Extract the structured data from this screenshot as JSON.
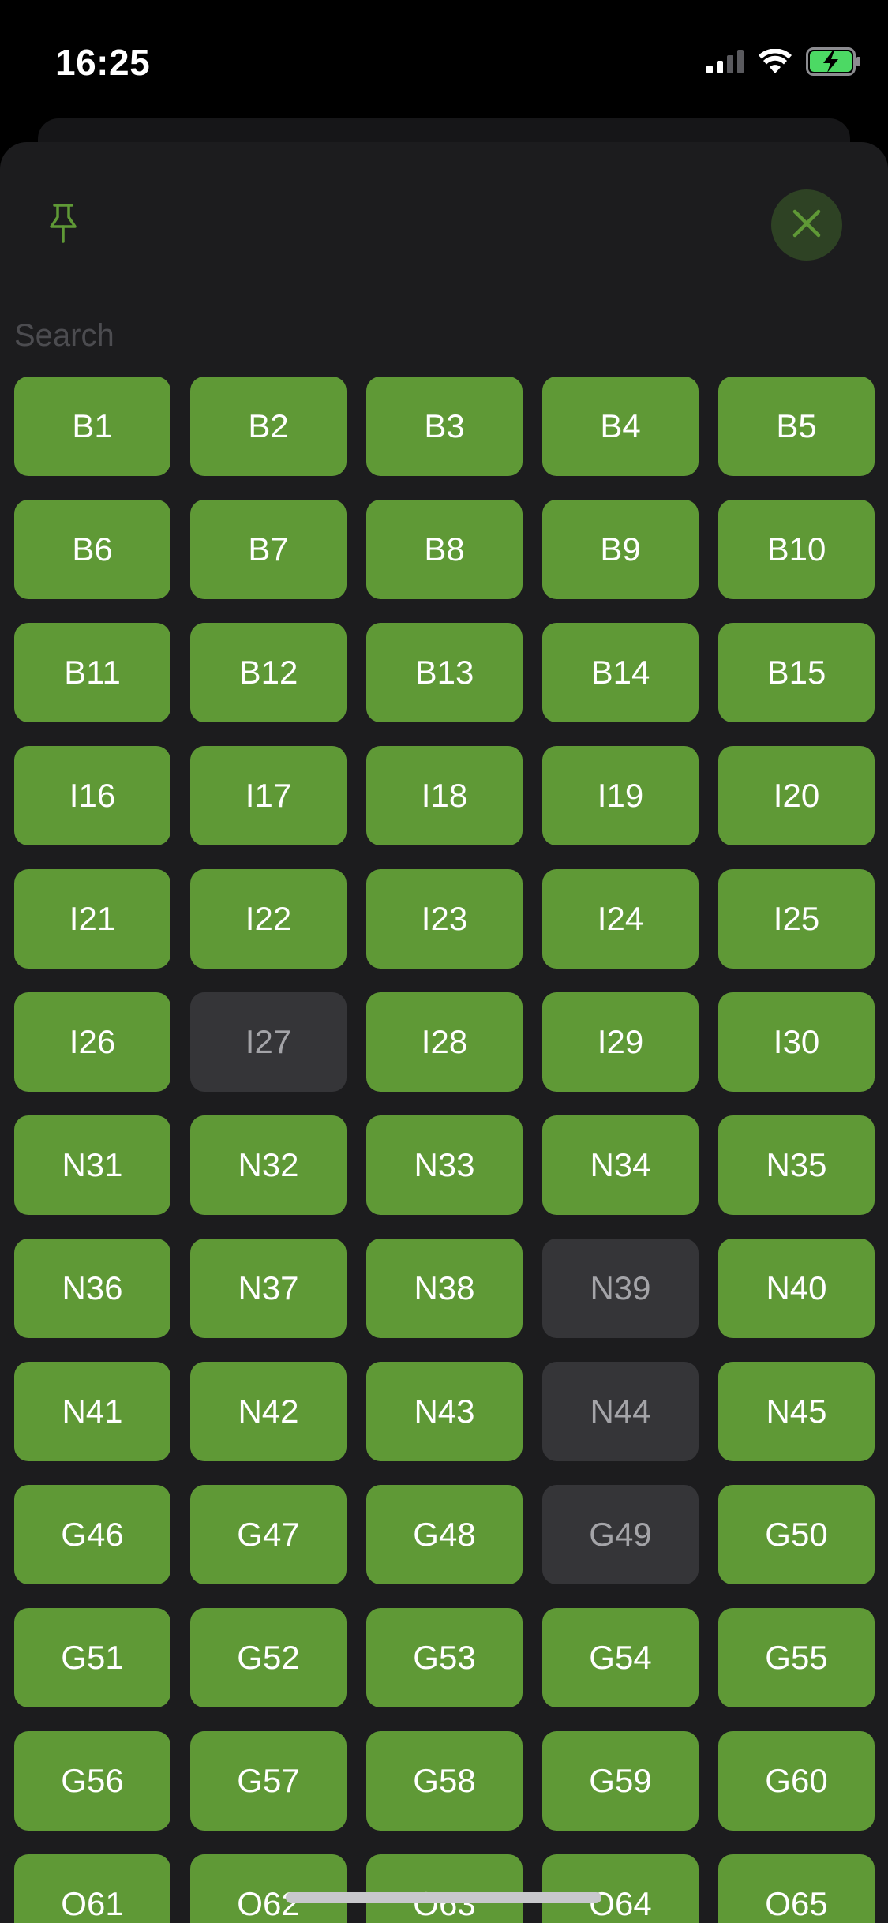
{
  "status_bar": {
    "time": "16:25",
    "icons": [
      "cellular-signal-icon",
      "wifi-icon",
      "battery-charging-icon"
    ]
  },
  "toolbar": {
    "pin_icon": "pin-icon",
    "close_icon": "close-icon"
  },
  "search": {
    "placeholder": "Search",
    "value": ""
  },
  "numbers": [
    {
      "label": "B1",
      "active": true
    },
    {
      "label": "B2",
      "active": true
    },
    {
      "label": "B3",
      "active": true
    },
    {
      "label": "B4",
      "active": true
    },
    {
      "label": "B5",
      "active": true
    },
    {
      "label": "B6",
      "active": true
    },
    {
      "label": "B7",
      "active": true
    },
    {
      "label": "B8",
      "active": true
    },
    {
      "label": "B9",
      "active": true
    },
    {
      "label": "B10",
      "active": true
    },
    {
      "label": "B11",
      "active": true
    },
    {
      "label": "B12",
      "active": true
    },
    {
      "label": "B13",
      "active": true
    },
    {
      "label": "B14",
      "active": true
    },
    {
      "label": "B15",
      "active": true
    },
    {
      "label": "I16",
      "active": true
    },
    {
      "label": "I17",
      "active": true
    },
    {
      "label": "I18",
      "active": true
    },
    {
      "label": "I19",
      "active": true
    },
    {
      "label": "I20",
      "active": true
    },
    {
      "label": "I21",
      "active": true
    },
    {
      "label": "I22",
      "active": true
    },
    {
      "label": "I23",
      "active": true
    },
    {
      "label": "I24",
      "active": true
    },
    {
      "label": "I25",
      "active": true
    },
    {
      "label": "I26",
      "active": true
    },
    {
      "label": "I27",
      "active": false
    },
    {
      "label": "I28",
      "active": true
    },
    {
      "label": "I29",
      "active": true
    },
    {
      "label": "I30",
      "active": true
    },
    {
      "label": "N31",
      "active": true
    },
    {
      "label": "N32",
      "active": true
    },
    {
      "label": "N33",
      "active": true
    },
    {
      "label": "N34",
      "active": true
    },
    {
      "label": "N35",
      "active": true
    },
    {
      "label": "N36",
      "active": true
    },
    {
      "label": "N37",
      "active": true
    },
    {
      "label": "N38",
      "active": true
    },
    {
      "label": "N39",
      "active": false
    },
    {
      "label": "N40",
      "active": true
    },
    {
      "label": "N41",
      "active": true
    },
    {
      "label": "N42",
      "active": true
    },
    {
      "label": "N43",
      "active": true
    },
    {
      "label": "N44",
      "active": false
    },
    {
      "label": "N45",
      "active": true
    },
    {
      "label": "G46",
      "active": true
    },
    {
      "label": "G47",
      "active": true
    },
    {
      "label": "G48",
      "active": true
    },
    {
      "label": "G49",
      "active": false
    },
    {
      "label": "G50",
      "active": true
    },
    {
      "label": "G51",
      "active": true
    },
    {
      "label": "G52",
      "active": true
    },
    {
      "label": "G53",
      "active": true
    },
    {
      "label": "G54",
      "active": true
    },
    {
      "label": "G55",
      "active": true
    },
    {
      "label": "G56",
      "active": true
    },
    {
      "label": "G57",
      "active": true
    },
    {
      "label": "G58",
      "active": true
    },
    {
      "label": "G59",
      "active": true
    },
    {
      "label": "G60",
      "active": true
    },
    {
      "label": "O61",
      "active": true
    },
    {
      "label": "O62",
      "active": true
    },
    {
      "label": "O63",
      "active": true
    },
    {
      "label": "O64",
      "active": true
    },
    {
      "label": "O65",
      "active": true
    }
  ],
  "colors": {
    "accent": "#5f9936",
    "inactive": "#353538",
    "sheet_background": "#1c1c1e",
    "close_button_background": "#2e4224"
  }
}
